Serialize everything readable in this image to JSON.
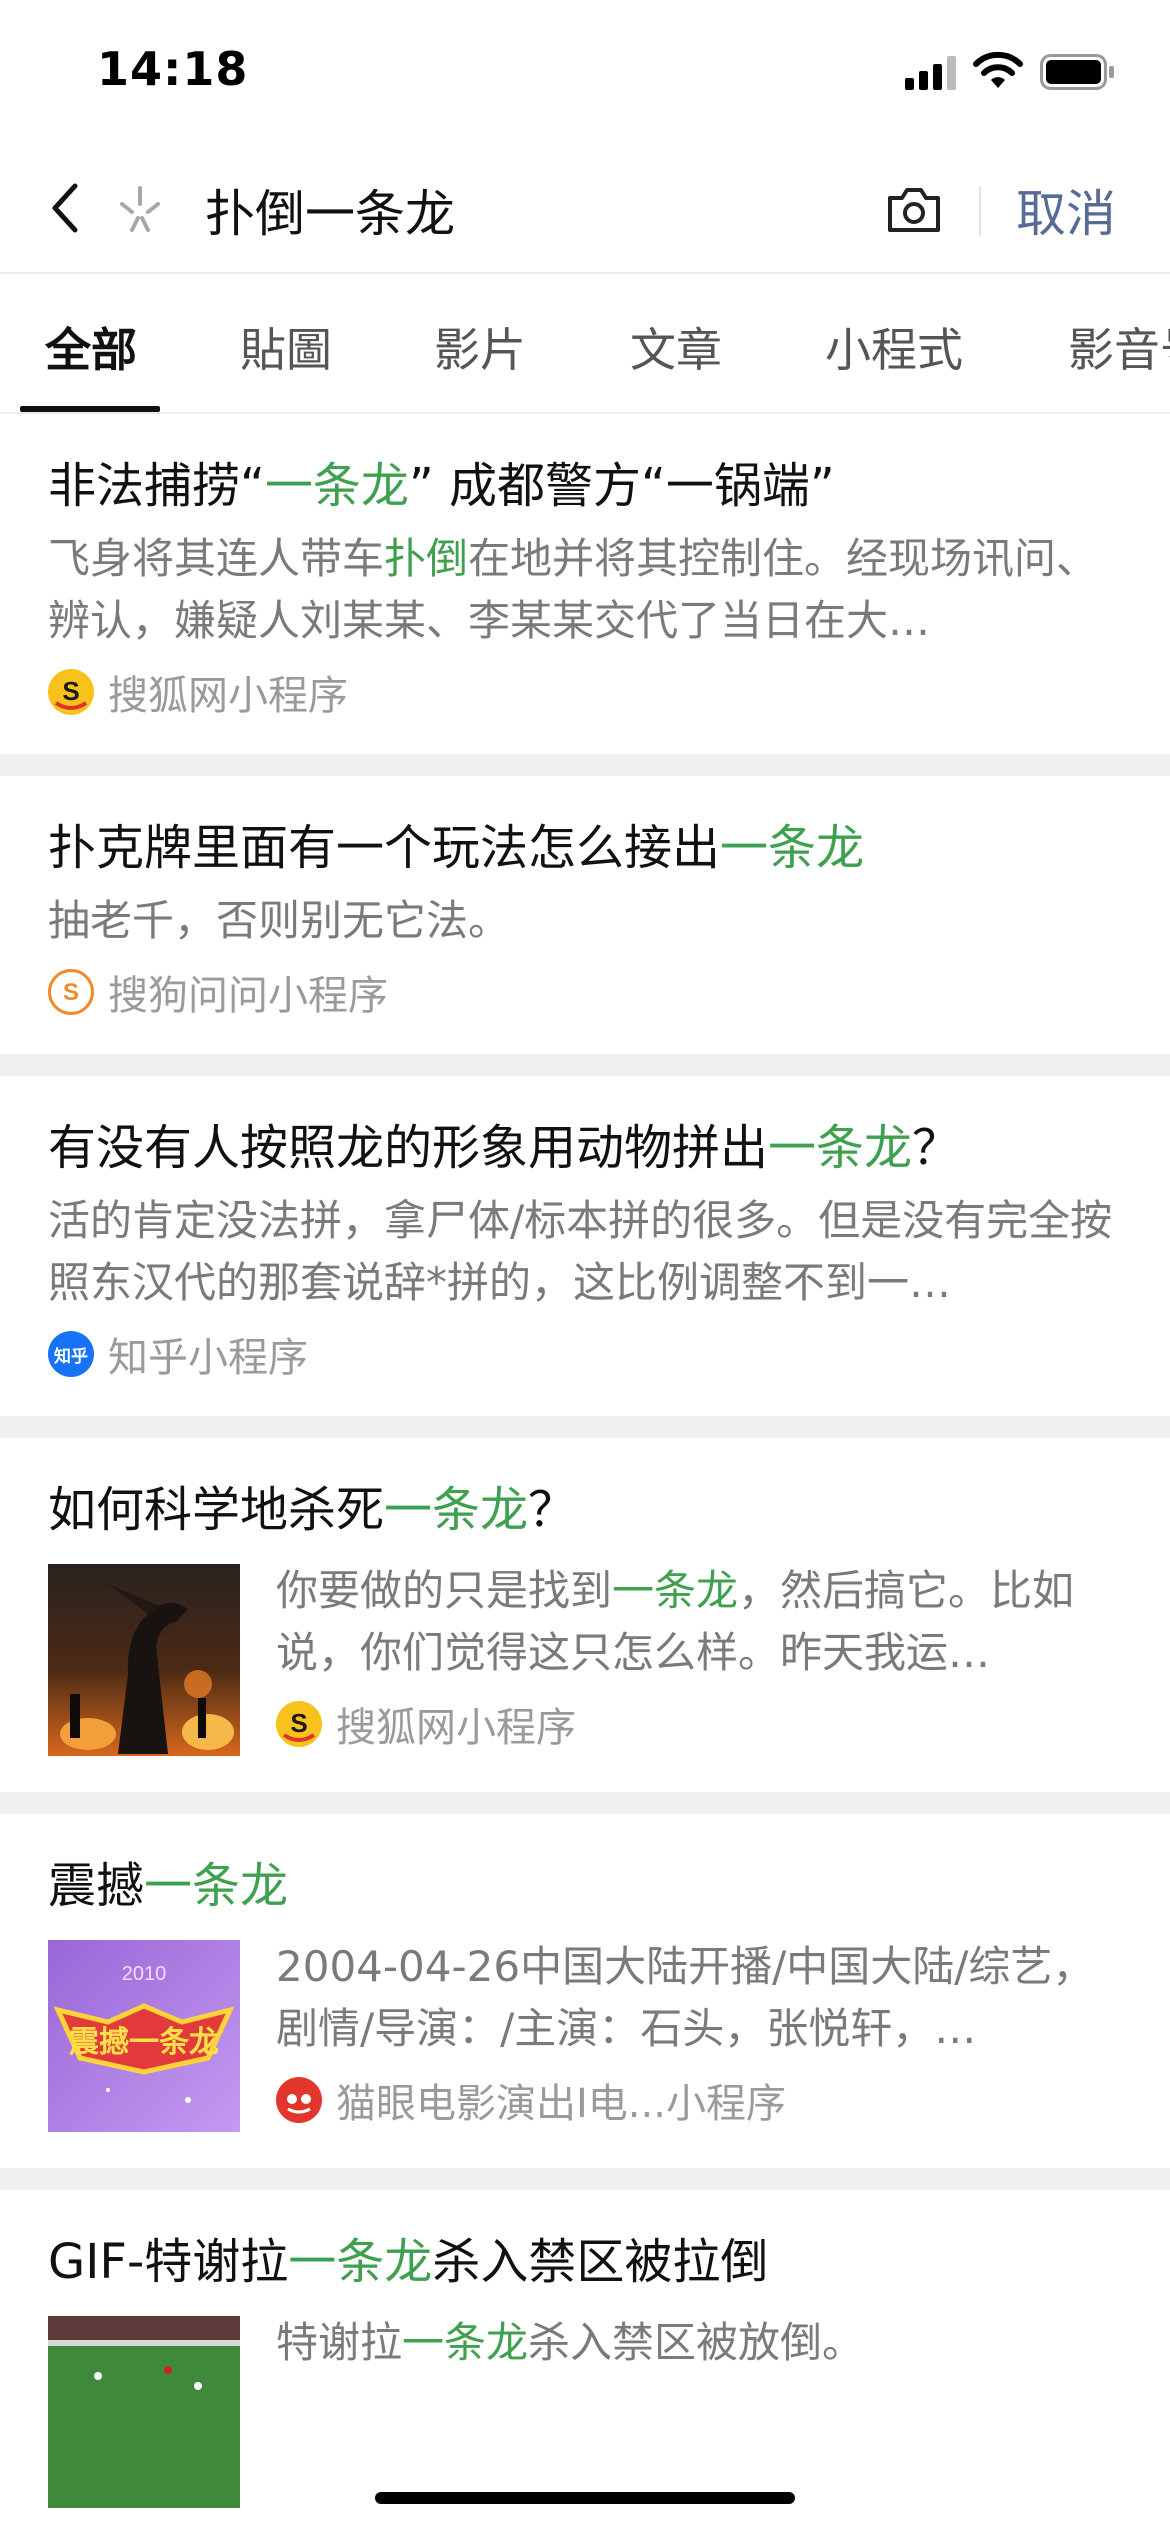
{
  "status_bar": {
    "time": "14:18"
  },
  "search": {
    "query": "扑倒一条龙",
    "cancel_label": "取消"
  },
  "tabs": [
    {
      "label": "全部",
      "active": true
    },
    {
      "label": "貼圖"
    },
    {
      "label": "影片"
    },
    {
      "label": "文章"
    },
    {
      "label": "小程式"
    },
    {
      "label": "影音号"
    }
  ],
  "results": [
    {
      "title_pre": "非法捕捞“",
      "title_hl": "一条龙",
      "title_post": "” 成都警方“一锅端”",
      "desc_pre": "飞身将其连人带车",
      "desc_hl": "扑倒",
      "desc_post": "在地并将其控制住。经现场讯问、辨认，嫌疑人刘某某、李某某交代了当日在大…",
      "source": "搜狐网小程序",
      "source_icon": "sohu-icon"
    },
    {
      "title_pre": "扑克牌里面有一个玩法怎么接出",
      "title_hl": "一条龙",
      "title_post": "",
      "desc_pre": "抽老千，否则别无它法。",
      "desc_hl": "",
      "desc_post": "",
      "source": "搜狗问问小程序",
      "source_icon": "sogou-icon"
    },
    {
      "title_pre": "有没有人按照龙的形象用动物拼出",
      "title_hl": "一条龙",
      "title_post": "？",
      "desc_pre": "活的肯定没法拼，拿尸体/标本拼的很多。但是没有完全按照东汉代的那套说辞*拼的，这比例调整不到一…",
      "desc_hl": "",
      "desc_post": "",
      "source": "知乎小程序",
      "source_icon": "zhihu-icon",
      "source_icon_text": "知乎"
    },
    {
      "title_pre": "如何科学地杀死",
      "title_hl": "一条龙",
      "title_post": "？",
      "desc_pre": "你要做的只是找到",
      "desc_hl": "一条龙",
      "desc_post": "，然后搞它。比如说，你们觉得这只怎么样。昨天我运…",
      "source": "搜狐网小程序",
      "source_icon": "sohu-icon"
    },
    {
      "title_pre": "震撼",
      "title_hl": "一条龙",
      "title_post": "",
      "desc_pre": "2004-04-26中国大陆开播/中国大陆/综艺，剧情/导演：/主演：石头，张悦轩，…",
      "desc_hl": "",
      "desc_post": "",
      "source": "猫眼电影演出I电...小程序",
      "source_icon": "maoyan-icon",
      "thumb_text": "2010",
      "thumb_title": "震撼一条龙"
    },
    {
      "title_pre": "GIF-特谢拉",
      "title_hl": "一条龙",
      "title_post": "杀入禁区被拉倒",
      "desc_pre": "特谢拉",
      "desc_hl": "一条龙",
      "desc_post": "杀入禁区被放倒。",
      "source": "",
      "source_icon": ""
    }
  ],
  "colors": {
    "highlight": "#3fa050",
    "link": "#576b95",
    "muted": "#7a7a7a"
  }
}
